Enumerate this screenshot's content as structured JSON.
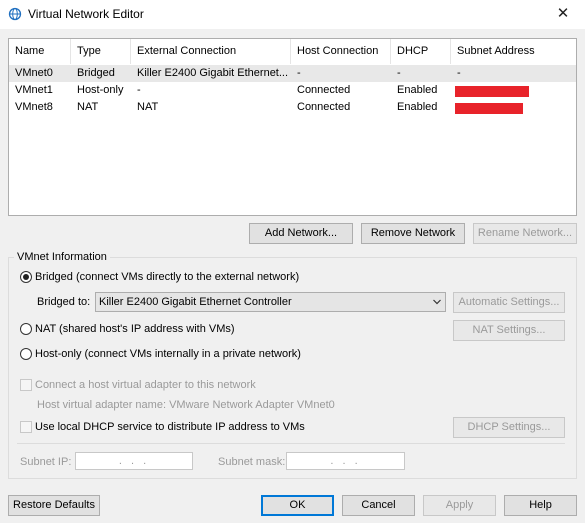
{
  "window": {
    "title": "Virtual Network Editor",
    "close_glyph": "✕",
    "icon": "network-globe-icon"
  },
  "table": {
    "columns": [
      "Name",
      "Type",
      "External Connection",
      "Host Connection",
      "DHCP",
      "Subnet Address"
    ],
    "rows": [
      {
        "name": "VMnet0",
        "type": "Bridged",
        "external": "Killer E2400 Gigabit Ethernet...",
        "host": "-",
        "dhcp": "-",
        "subnet": "-",
        "subnet_redacted": false
      },
      {
        "name": "VMnet1",
        "type": "Host-only",
        "external": "-",
        "host": "Connected",
        "dhcp": "Enabled",
        "subnet": "",
        "subnet_redacted": true
      },
      {
        "name": "VMnet8",
        "type": "NAT",
        "external": "NAT",
        "host": "Connected",
        "dhcp": "Enabled",
        "subnet": "",
        "subnet_redacted": true
      }
    ],
    "selected_row": 0,
    "redaction_color": "#e8232a"
  },
  "network_buttons": {
    "add": "Add Network...",
    "remove": "Remove Network",
    "rename": "Rename Network..."
  },
  "vmnet_info": {
    "group_label": "VMnet Information",
    "bridged_label": "Bridged (connect VMs directly to the external network)",
    "bridged_to_label": "Bridged to:",
    "bridged_to_value": "Killer E2400 Gigabit Ethernet Controller",
    "auto_settings": "Automatic Settings...",
    "nat_label": "NAT (shared host's IP address with VMs)",
    "nat_settings": "NAT Settings...",
    "hostonly_label": "Host-only (connect VMs internally in a private network)",
    "selected_mode": "bridged",
    "connect_adapter_label": "Connect a host virtual adapter to this network",
    "adapter_name_text": "Host virtual adapter name: VMware Network Adapter VMnet0",
    "dhcp_label": "Use local DHCP service to distribute IP address to VMs",
    "dhcp_settings": "DHCP Settings...",
    "subnet_ip_label": "Subnet IP:",
    "subnet_mask_label": "Subnet mask:",
    "ip_placeholder": ". . .",
    "mask_placeholder": ". . ."
  },
  "footer": {
    "restore": "Restore Defaults",
    "ok": "OK",
    "cancel": "Cancel",
    "apply": "Apply",
    "help": "Help"
  }
}
